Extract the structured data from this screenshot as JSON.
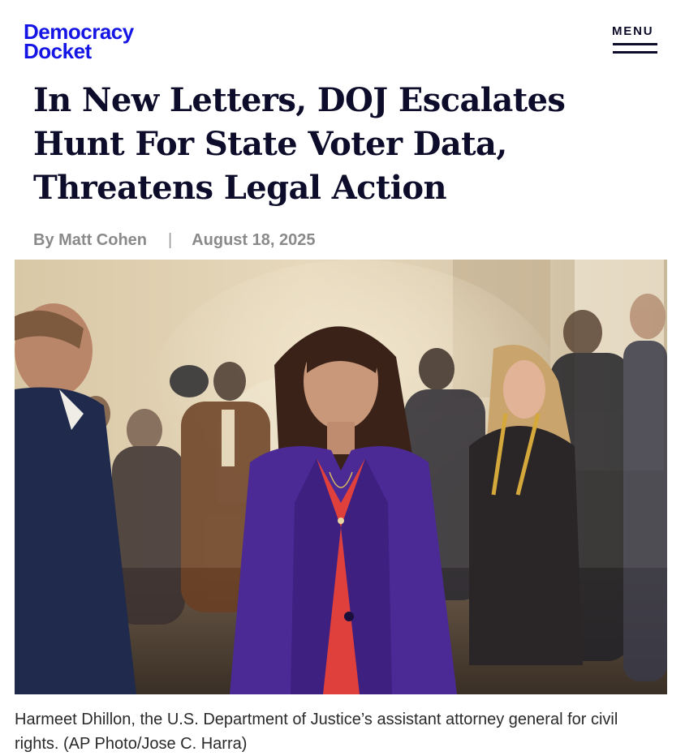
{
  "site": {
    "logo_line1": "Democracy",
    "logo_line2": "Docket",
    "menu_label": "MENU",
    "brand_color": "#1515e6"
  },
  "article": {
    "headline": "In New Letters, DOJ Escalates Hunt For State Voter Data, Threatens Legal Action",
    "author": "By Matt Cohen",
    "separator": "|",
    "date": "August 18, 2025",
    "caption": "Harmeet Dhillon, the U.S. Department of Justice’s assistant attorney general for civil rights. (AP Photo/Jose C. Harra)"
  },
  "icons": {
    "menu": "hamburger-icon"
  }
}
